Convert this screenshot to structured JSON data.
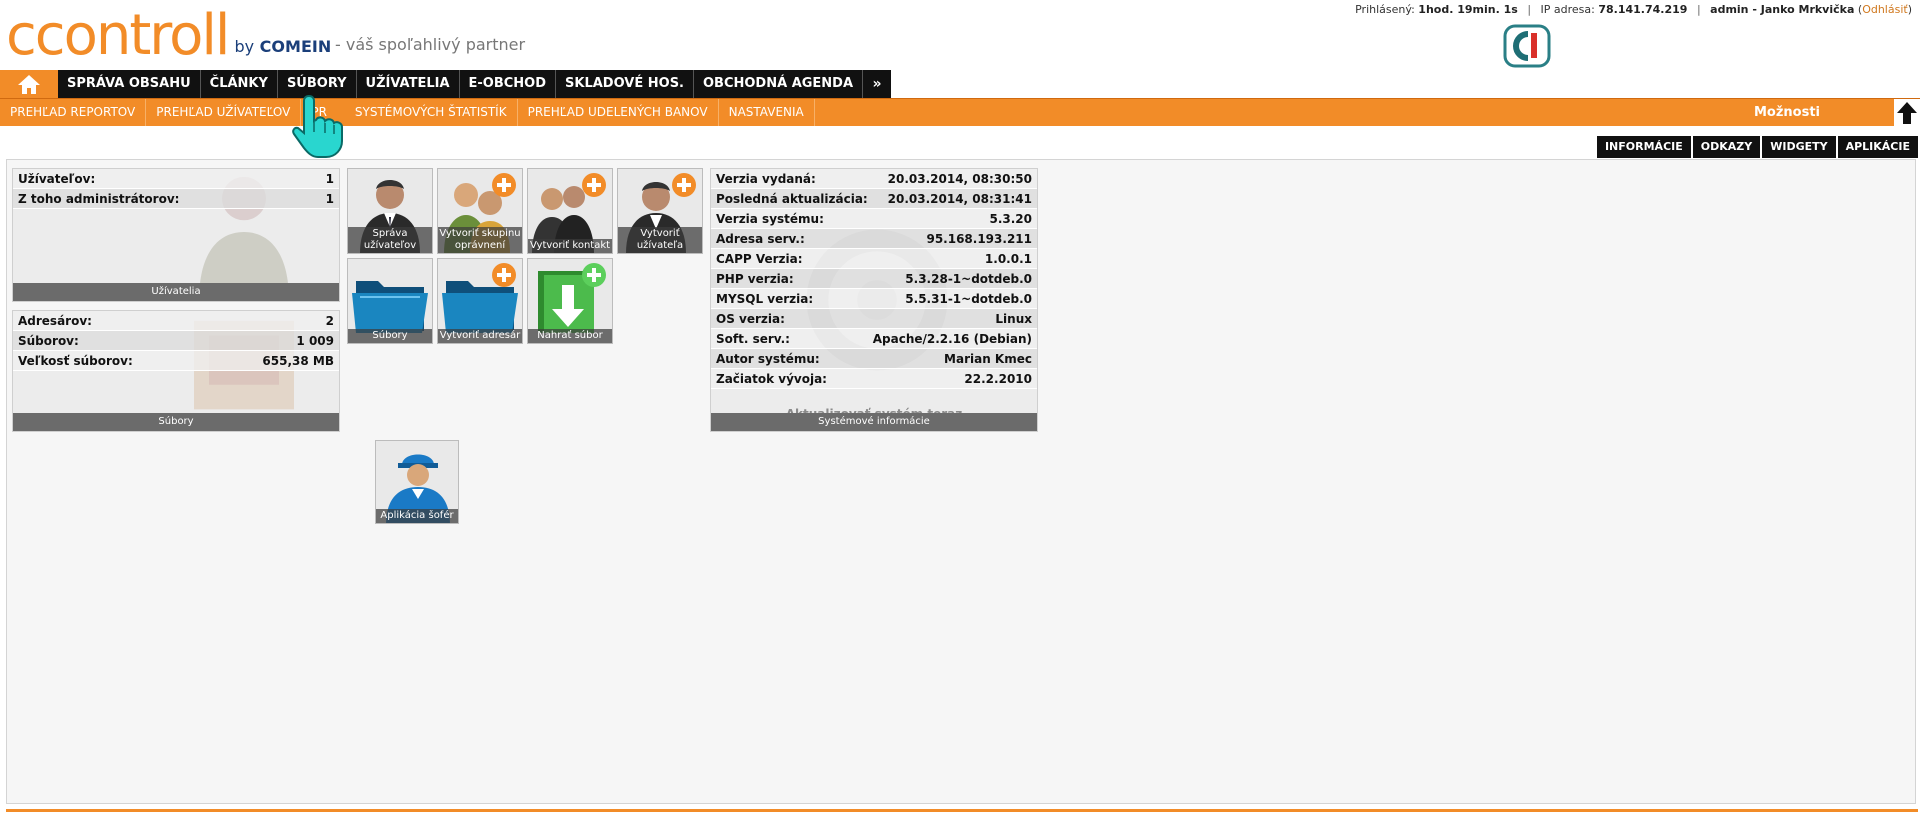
{
  "header": {
    "logo_text": "ccontroll",
    "logo_by": "by",
    "logo_company": "COMEIN",
    "tagline": "- váš spoľahlivý partner",
    "user_bar": {
      "logged_label": "Prihlásený:",
      "logged_time": "1hod. 19min. 1s",
      "ip_label": "IP adresa:",
      "ip_value": "78.141.74.219",
      "user": "admin - Janko Mrkvička",
      "logout_open": "(",
      "logout": "Odhlásiť",
      "logout_close": ")"
    }
  },
  "main_nav": {
    "items": [
      "SPRÁVA OBSAHU",
      "ČLÁNKY",
      "SÚBORY",
      "UŽÍVATELIA",
      "E-OBCHOD",
      "SKLADOVÉ HOS.",
      "OBCHODNÁ AGENDA"
    ],
    "more": "»"
  },
  "sub_nav": {
    "items": [
      "PREHĽAD REPORTOV",
      "PREHĽAD UŽÍVATEĽOV",
      "PR",
      "SYSTÉMOVÝCH ŠTATISTÍK",
      "PREHĽAD UDELENÝCH BANOV",
      "NASTAVENIA"
    ],
    "options": "Možnosti"
  },
  "right_tabs": [
    "INFORMÁCIE",
    "ODKAZY",
    "WIDGETY",
    "APLIKÁCIE"
  ],
  "users_widget": {
    "rows": [
      {
        "label": "Užívateľov:",
        "value": "1"
      },
      {
        "label": "Z toho administrátorov:",
        "value": "1"
      }
    ],
    "footer": "Užívatelia"
  },
  "files_widget": {
    "rows": [
      {
        "label": "Adresárov:",
        "value": "2"
      },
      {
        "label": "Súborov:",
        "value": "1 009"
      },
      {
        "label": "Veľkosť súborov:",
        "value": "655,38 MB"
      }
    ],
    "footer": "Súbory"
  },
  "tiles": [
    {
      "label": "Správa užívateľov",
      "icon": "user-icon"
    },
    {
      "label": "Vytvoriť skupinu oprávnení",
      "icon": "group-add-icon"
    },
    {
      "label": "Vytvoriť kontakt",
      "icon": "contact-add-icon"
    },
    {
      "label": "Vytvoriť užívateľa",
      "icon": "user-add-icon"
    },
    {
      "label": "Súbory",
      "icon": "folder-icon"
    },
    {
      "label": "Vytvoriť adresár",
      "icon": "folder-add-icon"
    },
    {
      "label": "Nahrať súbor",
      "icon": "upload-icon"
    },
    {
      "label": "Aplikácia šofér",
      "icon": "driver-icon"
    }
  ],
  "system_widget": {
    "rows": [
      {
        "label": "Verzia vydaná:",
        "value": "20.03.2014, 08:30:50"
      },
      {
        "label": "Posledná aktualizácia:",
        "value": "20.03.2014, 08:31:41"
      },
      {
        "label": "Verzia systému:",
        "value": "5.3.20"
      },
      {
        "label": "Adresa serv.:",
        "value": "95.168.193.211"
      },
      {
        "label": "CAPP Verzia:",
        "value": "1.0.0.1"
      },
      {
        "label": "PHP verzia:",
        "value": "5.3.28-1~dotdeb.0"
      },
      {
        "label": "MYSQL verzia:",
        "value": "5.5.31-1~dotdeb.0"
      },
      {
        "label": "OS verzia:",
        "value": "Linux"
      },
      {
        "label": "Soft. serv.:",
        "value": "Apache/2.2.16 (Debian)"
      },
      {
        "label": "Autor systému:",
        "value": "Marian Kmec"
      },
      {
        "label": "Začiatok vývoja:",
        "value": "22.2.2010"
      }
    ],
    "update_text": "Aktualizovať systém teraz",
    "footer": "Systémové informácie"
  },
  "colors": {
    "accent": "#f28c28",
    "nav_bg": "#111111",
    "brand_blue": "#1b3f7a"
  }
}
